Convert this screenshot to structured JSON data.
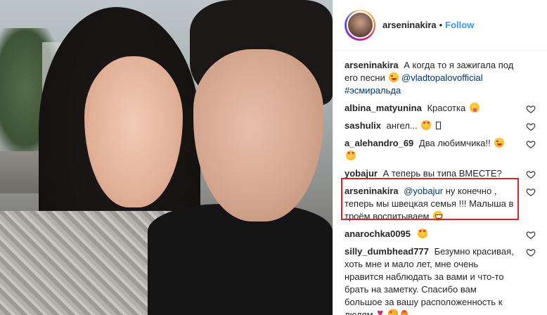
{
  "post": {
    "username": "arseninakira",
    "separator": "•",
    "follow_label": "Follow"
  },
  "comments": [
    {
      "user": "arseninakira",
      "text": "А когда то я зажигала под его песни",
      "emoji": [
        "wink-face"
      ],
      "mention": "@vladtopalovofficial",
      "hashtag": "#эсмиральда",
      "has_like": false
    },
    {
      "user": "albina_matyunina",
      "text": "Красотка",
      "emoji": [
        "tongue-face"
      ],
      "has_like": true
    },
    {
      "user": "sashulix",
      "text": "ангел...",
      "emoji": [
        "heart-eyes-face",
        "missing-glyph"
      ],
      "has_like": true
    },
    {
      "user": "a_alehandro_69",
      "text": "Два любимчика!!",
      "emoji": [
        "wink-face",
        "heart-eyes-face"
      ],
      "has_like": true
    },
    {
      "user": "yobajur",
      "text": "А теперь вы типа ВМЕСТЕ?",
      "emoji": [],
      "has_like": true
    },
    {
      "user": "arseninakira",
      "mention": "@yobajur",
      "text": "ну конечно , теперь мы швецкая семья !!! Малыша в троём воспитываем",
      "emoji": [
        "grinning-sweat-face"
      ],
      "has_like": true,
      "highlighted": true
    },
    {
      "user": "anarochka0095",
      "text": "",
      "emoji": [
        "heart-eyes-face"
      ],
      "has_like": true
    },
    {
      "user": "silly_dumbhead777",
      "text": "Безумно красивая, хоть мне и мало лет, мне очень нравится наблюдать за вами и что-то брать на заметку. Спасибо вам большое за вашу расположенность к людям",
      "emoji": [
        "red-heart",
        "heart-eyes-cat",
        "fire"
      ],
      "has_like": true
    }
  ],
  "colors": {
    "accent_blue": "#3897f0",
    "link_dark_blue": "#003569",
    "highlight_red": "#e0202a",
    "text": "#262626"
  }
}
